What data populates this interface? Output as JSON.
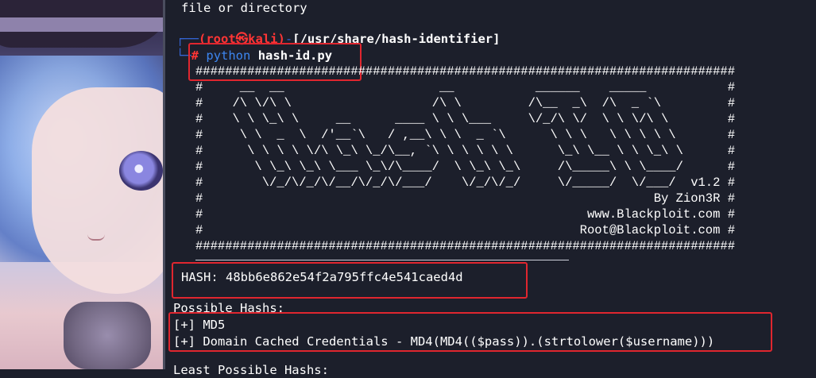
{
  "terminal": {
    "top_line": "file or directory",
    "prompt": {
      "corner_top": "┌──",
      "user_host": "(root㉿kali)",
      "dash": "-",
      "path": "[/usr/share/hash-identifier]",
      "corner_bottom": "└─",
      "symbol": "#",
      "command": "python",
      "argument": "hash-id.py"
    },
    "banner": [
      "#########################################################################",
      "#     __  __                     __           ______    _____           #",
      "#    /\\ \\/\\ \\                   /\\ \\         /\\__  _\\  /\\  _ `\\         #",
      "#    \\ \\ \\_\\ \\     __      ____ \\ \\ \\___     \\/_/\\ \\/  \\ \\ \\/\\ \\        #",
      "#     \\ \\  _  \\  /'__`\\   / ,__\\ \\ \\  _ `\\      \\ \\ \\   \\ \\ \\ \\ \\       #",
      "#      \\ \\ \\ \\ \\/\\ \\_\\ \\_/\\__, `\\ \\ \\ \\ \\ \\      \\_\\ \\__ \\ \\ \\_\\ \\      #",
      "#       \\ \\_\\ \\_\\ \\___ \\_\\/\\____/  \\ \\_\\ \\_\\     /\\_____\\ \\ \\____/      #",
      "#        \\/_/\\/_/\\/__/\\/_/\\/___/    \\/_/\\/_/     \\/_____/  \\/___/  v1.2 #",
      "#                                                             By Zion3R #",
      "#                                                    www.Blackploit.com #",
      "#                                                   Root@Blackploit.com #",
      "#########################################################################"
    ],
    "hash_label": "HASH: 48bb6e862e54f2a795ffc4e541caed4d",
    "possible_title": "Possible Hashs:",
    "results": [
      "[+] MD5",
      "[+] Domain Cached Credentials - MD4(MD4(($pass)).(strtolower($username)))"
    ],
    "bottom_partial": "Least Possible Hashs:"
  },
  "colors": {
    "background": "#1c1f2b",
    "highlight_box": "#e0262f",
    "prompt_user": "#ff3535",
    "prompt_glyph": "#3465d4",
    "command": "#3d86f0"
  }
}
